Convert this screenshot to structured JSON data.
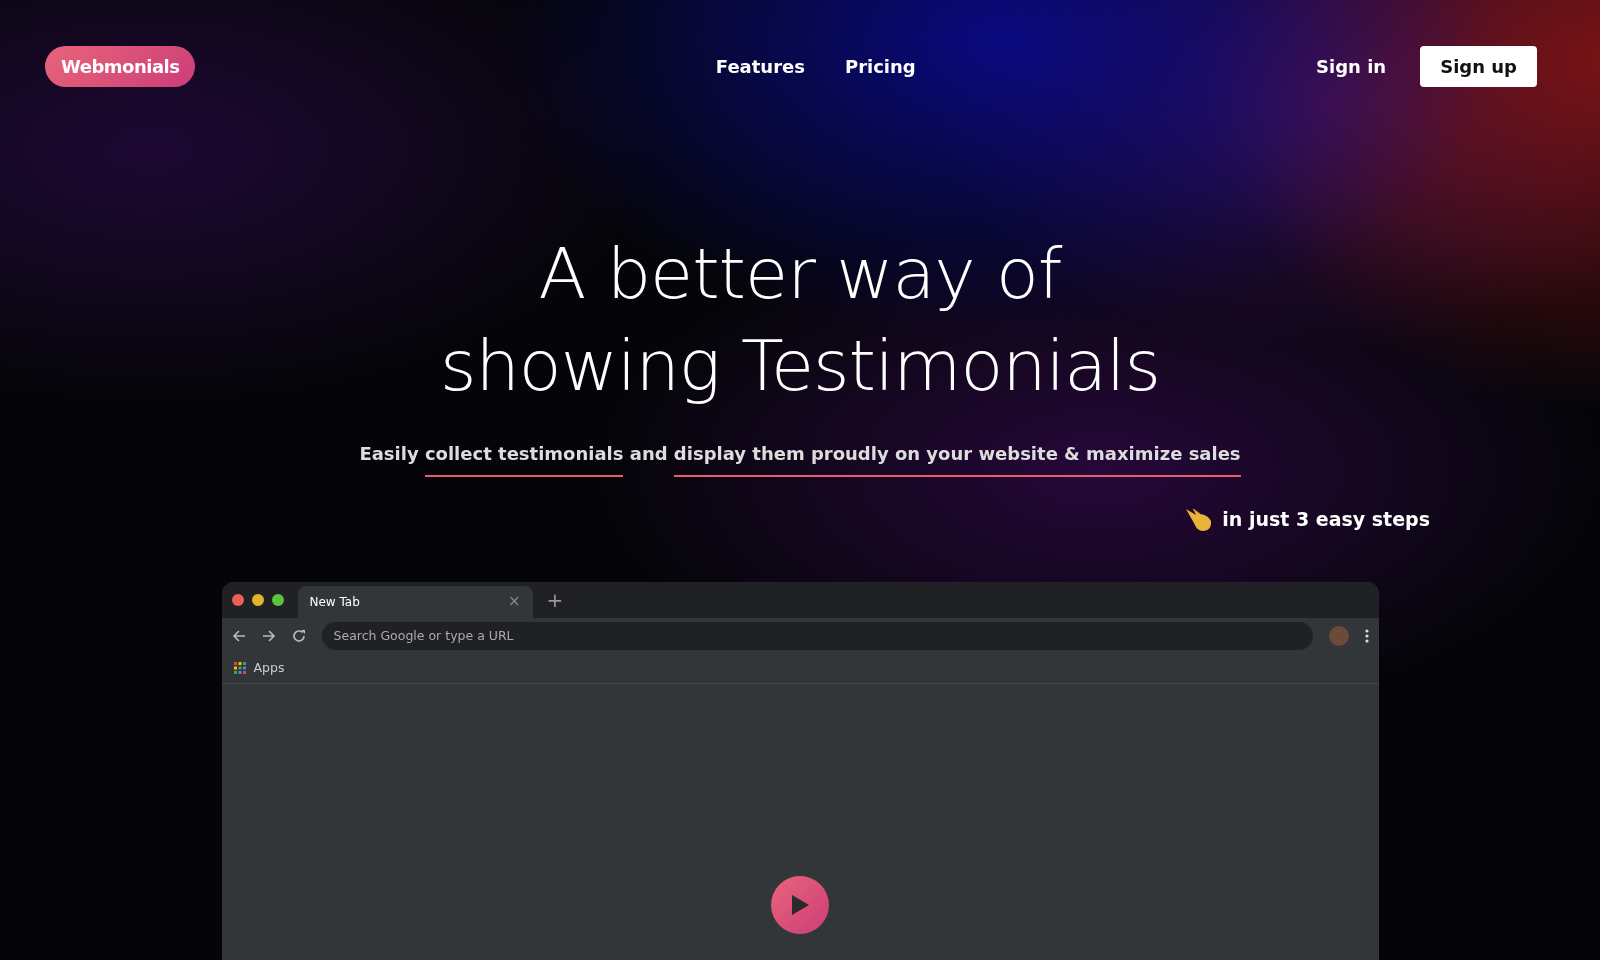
{
  "brand": {
    "logo": "Webmonials"
  },
  "nav": {
    "links": [
      "Features",
      "Pricing"
    ],
    "sign_in": "Sign in",
    "sign_up": "Sign up"
  },
  "hero": {
    "title_lines": [
      "A better way of",
      "showing Testimonials"
    ],
    "subtitle": [
      {
        "text": "Easily ",
        "underlined": false
      },
      {
        "text": "collect testimonials",
        "underlined": true
      },
      {
        "text": " and ",
        "underlined": false
      },
      {
        "text": "display them proudly on your website & maximize sales",
        "underlined": true
      }
    ],
    "steps_note": "in just 3 easy steps"
  },
  "browser": {
    "tabs": [
      {
        "label": "New Tab",
        "selected": true,
        "close": "×"
      }
    ],
    "new_tab": "+",
    "address_placeholder": "Search Google or type a URL",
    "bookmarks": [
      "Apps"
    ]
  }
}
